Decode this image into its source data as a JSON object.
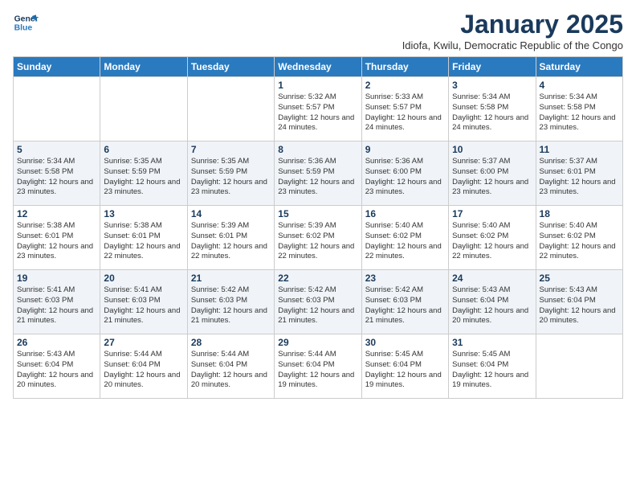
{
  "logo": {
    "line1": "General",
    "line2": "Blue"
  },
  "title": "January 2025",
  "subtitle": "Idiofa, Kwilu, Democratic Republic of the Congo",
  "days_of_week": [
    "Sunday",
    "Monday",
    "Tuesday",
    "Wednesday",
    "Thursday",
    "Friday",
    "Saturday"
  ],
  "weeks": [
    [
      {
        "day": "",
        "sunrise": "",
        "sunset": "",
        "daylight": ""
      },
      {
        "day": "",
        "sunrise": "",
        "sunset": "",
        "daylight": ""
      },
      {
        "day": "",
        "sunrise": "",
        "sunset": "",
        "daylight": ""
      },
      {
        "day": "1",
        "sunrise": "Sunrise: 5:32 AM",
        "sunset": "Sunset: 5:57 PM",
        "daylight": "Daylight: 12 hours and 24 minutes."
      },
      {
        "day": "2",
        "sunrise": "Sunrise: 5:33 AM",
        "sunset": "Sunset: 5:57 PM",
        "daylight": "Daylight: 12 hours and 24 minutes."
      },
      {
        "day": "3",
        "sunrise": "Sunrise: 5:34 AM",
        "sunset": "Sunset: 5:58 PM",
        "daylight": "Daylight: 12 hours and 24 minutes."
      },
      {
        "day": "4",
        "sunrise": "Sunrise: 5:34 AM",
        "sunset": "Sunset: 5:58 PM",
        "daylight": "Daylight: 12 hours and 23 minutes."
      }
    ],
    [
      {
        "day": "5",
        "sunrise": "Sunrise: 5:34 AM",
        "sunset": "Sunset: 5:58 PM",
        "daylight": "Daylight: 12 hours and 23 minutes."
      },
      {
        "day": "6",
        "sunrise": "Sunrise: 5:35 AM",
        "sunset": "Sunset: 5:59 PM",
        "daylight": "Daylight: 12 hours and 23 minutes."
      },
      {
        "day": "7",
        "sunrise": "Sunrise: 5:35 AM",
        "sunset": "Sunset: 5:59 PM",
        "daylight": "Daylight: 12 hours and 23 minutes."
      },
      {
        "day": "8",
        "sunrise": "Sunrise: 5:36 AM",
        "sunset": "Sunset: 5:59 PM",
        "daylight": "Daylight: 12 hours and 23 minutes."
      },
      {
        "day": "9",
        "sunrise": "Sunrise: 5:36 AM",
        "sunset": "Sunset: 6:00 PM",
        "daylight": "Daylight: 12 hours and 23 minutes."
      },
      {
        "day": "10",
        "sunrise": "Sunrise: 5:37 AM",
        "sunset": "Sunset: 6:00 PM",
        "daylight": "Daylight: 12 hours and 23 minutes."
      },
      {
        "day": "11",
        "sunrise": "Sunrise: 5:37 AM",
        "sunset": "Sunset: 6:01 PM",
        "daylight": "Daylight: 12 hours and 23 minutes."
      }
    ],
    [
      {
        "day": "12",
        "sunrise": "Sunrise: 5:38 AM",
        "sunset": "Sunset: 6:01 PM",
        "daylight": "Daylight: 12 hours and 23 minutes."
      },
      {
        "day": "13",
        "sunrise": "Sunrise: 5:38 AM",
        "sunset": "Sunset: 6:01 PM",
        "daylight": "Daylight: 12 hours and 22 minutes."
      },
      {
        "day": "14",
        "sunrise": "Sunrise: 5:39 AM",
        "sunset": "Sunset: 6:01 PM",
        "daylight": "Daylight: 12 hours and 22 minutes."
      },
      {
        "day": "15",
        "sunrise": "Sunrise: 5:39 AM",
        "sunset": "Sunset: 6:02 PM",
        "daylight": "Daylight: 12 hours and 22 minutes."
      },
      {
        "day": "16",
        "sunrise": "Sunrise: 5:40 AM",
        "sunset": "Sunset: 6:02 PM",
        "daylight": "Daylight: 12 hours and 22 minutes."
      },
      {
        "day": "17",
        "sunrise": "Sunrise: 5:40 AM",
        "sunset": "Sunset: 6:02 PM",
        "daylight": "Daylight: 12 hours and 22 minutes."
      },
      {
        "day": "18",
        "sunrise": "Sunrise: 5:40 AM",
        "sunset": "Sunset: 6:02 PM",
        "daylight": "Daylight: 12 hours and 22 minutes."
      }
    ],
    [
      {
        "day": "19",
        "sunrise": "Sunrise: 5:41 AM",
        "sunset": "Sunset: 6:03 PM",
        "daylight": "Daylight: 12 hours and 21 minutes."
      },
      {
        "day": "20",
        "sunrise": "Sunrise: 5:41 AM",
        "sunset": "Sunset: 6:03 PM",
        "daylight": "Daylight: 12 hours and 21 minutes."
      },
      {
        "day": "21",
        "sunrise": "Sunrise: 5:42 AM",
        "sunset": "Sunset: 6:03 PM",
        "daylight": "Daylight: 12 hours and 21 minutes."
      },
      {
        "day": "22",
        "sunrise": "Sunrise: 5:42 AM",
        "sunset": "Sunset: 6:03 PM",
        "daylight": "Daylight: 12 hours and 21 minutes."
      },
      {
        "day": "23",
        "sunrise": "Sunrise: 5:42 AM",
        "sunset": "Sunset: 6:03 PM",
        "daylight": "Daylight: 12 hours and 21 minutes."
      },
      {
        "day": "24",
        "sunrise": "Sunrise: 5:43 AM",
        "sunset": "Sunset: 6:04 PM",
        "daylight": "Daylight: 12 hours and 20 minutes."
      },
      {
        "day": "25",
        "sunrise": "Sunrise: 5:43 AM",
        "sunset": "Sunset: 6:04 PM",
        "daylight": "Daylight: 12 hours and 20 minutes."
      }
    ],
    [
      {
        "day": "26",
        "sunrise": "Sunrise: 5:43 AM",
        "sunset": "Sunset: 6:04 PM",
        "daylight": "Daylight: 12 hours and 20 minutes."
      },
      {
        "day": "27",
        "sunrise": "Sunrise: 5:44 AM",
        "sunset": "Sunset: 6:04 PM",
        "daylight": "Daylight: 12 hours and 20 minutes."
      },
      {
        "day": "28",
        "sunrise": "Sunrise: 5:44 AM",
        "sunset": "Sunset: 6:04 PM",
        "daylight": "Daylight: 12 hours and 20 minutes."
      },
      {
        "day": "29",
        "sunrise": "Sunrise: 5:44 AM",
        "sunset": "Sunset: 6:04 PM",
        "daylight": "Daylight: 12 hours and 19 minutes."
      },
      {
        "day": "30",
        "sunrise": "Sunrise: 5:45 AM",
        "sunset": "Sunset: 6:04 PM",
        "daylight": "Daylight: 12 hours and 19 minutes."
      },
      {
        "day": "31",
        "sunrise": "Sunrise: 5:45 AM",
        "sunset": "Sunset: 6:04 PM",
        "daylight": "Daylight: 12 hours and 19 minutes."
      },
      {
        "day": "",
        "sunrise": "",
        "sunset": "",
        "daylight": ""
      }
    ]
  ]
}
